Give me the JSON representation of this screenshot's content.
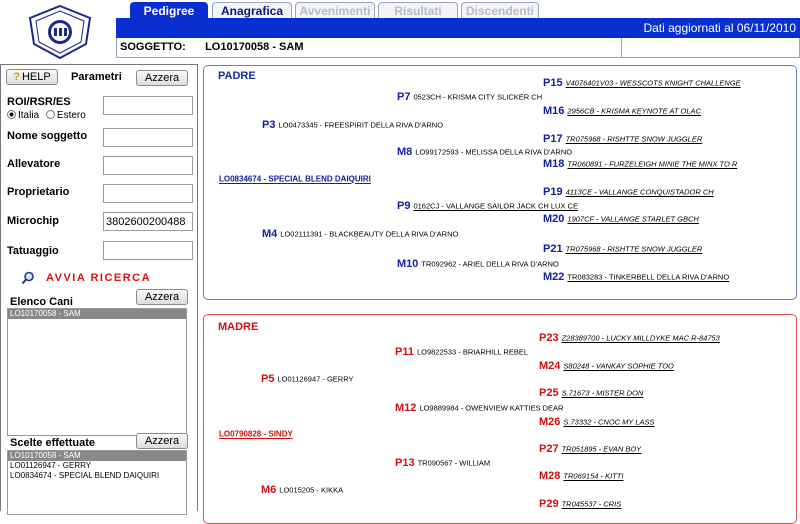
{
  "tabs": [
    {
      "label": "Pedigree",
      "state": "active"
    },
    {
      "label": "Anagrafica",
      "state": "enabled"
    },
    {
      "label": "Avvenimenti",
      "state": "disabled"
    },
    {
      "label": "Risultati",
      "state": "disabled"
    },
    {
      "label": "Discendenti",
      "state": "disabled"
    }
  ],
  "header": {
    "data_note": "Dati aggiornati al 06/11/2010"
  },
  "soggetto": {
    "label": "SOGGETTO:",
    "value": "LO10170058 - SAM"
  },
  "left": {
    "help_label": "HELP",
    "parametri_label": "Parametri",
    "azzera_label": "Azzera",
    "roi_label": "ROI/RSR/ES",
    "radio_italia": "Italia",
    "radio_estero": "Estero",
    "radio_selected": "Italia",
    "nome_label": "Nome soggetto",
    "allevatore_label": "Allevatore",
    "proprietario_label": "Proprietario",
    "microchip_label": "Microchip",
    "microchip_value": "3802600200488",
    "tatuaggio_label": "Tatuaggio",
    "avvia_label": "AVVIA RICERCA",
    "elenco_label": "Elenco Cani",
    "elenco_items": [
      {
        "text": "LO10170058 - SAM",
        "selected": true
      }
    ],
    "scelte_label": "Scelte effettuate",
    "scelte_items": [
      {
        "text": "LO10170058 - SAM",
        "selected": true
      },
      {
        "text": "LO01126947 - GERRY",
        "selected": false
      },
      {
        "text": "LO0834674 - SPECIAL BLEND DAIQUIRI",
        "selected": false
      }
    ]
  },
  "padre": {
    "title": "PADRE",
    "root": "LO0834674 - SPECIAL BLEND DAIQUIRI",
    "nodes": {
      "P3": "LO0473345 - FREESPIRIT DELLA RIVA D'ARNO",
      "P4": "LO02111391 - BLACKBEAUTY DELLA RIVA D'ARNO",
      "P7": "0523CH - KRISMA CITY SLICKER CH",
      "M8": "LO99172593 - MELISSA DELLA RIVA D'ARNO",
      "P9": "0162CJ - VALLANGE SAILOR JACK CH LUX CE",
      "M10": "TR092962 - ARIEL DELLA RIVA D'ARNO",
      "P15": "V4076401V03 - WESSCOTS KNIGHT CHALLENGE",
      "M16": "2956CB - KRISMA KEYNOTE AT OLAC",
      "P17": "TR075968 - RISHTTE SNOW JUGGLER",
      "M18": "TR060891 - FURZELEIGH MINIE THE MINX TO R",
      "P19": "4113CE - VALLANGE CONQUISTADOR CH",
      "M20": "1907CF - VALLANGE STARLET GBCH",
      "P21": "TR075968 - RISHTTE SNOW JUGGLER",
      "M22": "TR083283 - TINKERBELL DELLA RIVA D'ARNO"
    }
  },
  "madre": {
    "title": "MADRE",
    "root": "LO0790828 - SINDY",
    "nodes": {
      "P5": "LO01126947 - GERRY",
      "M6": "LO015205 - KIKKA",
      "P11": "LO9822533 - BRIARHILL REBEL",
      "M12": "LO9889984 - OWENVIEW KATTIES DEAR",
      "P13": "TR090567 - WILLIAM",
      "P23": "Z28389700 - LUCKY MILLDYKE MAC R-84753",
      "M24": "S80248 - VANKAY SOPHIE TOO",
      "P25": "S.71673 - MISTER DON",
      "M26": "S.73332 - CNOC MY LASS",
      "P27": "TR051895 - EVAN BOY",
      "M28": "TR069154 - KITTI",
      "P29": "TR045537 - CRIS"
    }
  }
}
